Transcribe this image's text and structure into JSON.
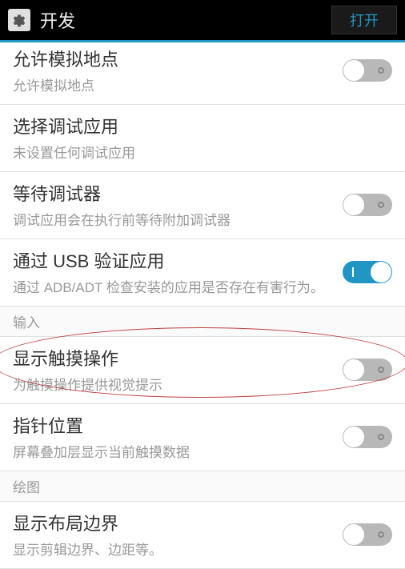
{
  "header": {
    "title": "开发",
    "open_button": "打开"
  },
  "settings": {
    "mock_location": {
      "title": "允许模拟地点",
      "subtitle": "允许模拟地点",
      "enabled": false
    },
    "debug_app": {
      "title": "选择调试应用",
      "subtitle": "未设置任何调试应用"
    },
    "wait_debugger": {
      "title": "等待调试器",
      "subtitle": "调试应用会在执行前等待附加调试器",
      "enabled": false
    },
    "usb_verify": {
      "title": "通过 USB 验证应用",
      "subtitle": "通过 ADB/ADT 检查安装的应用是否存在有害行为。",
      "enabled": true
    },
    "show_touches": {
      "title": "显示触摸操作",
      "subtitle": "为触摸操作提供视觉提示",
      "enabled": false
    },
    "pointer_location": {
      "title": "指针位置",
      "subtitle": "屏幕叠加层显示当前触摸数据",
      "enabled": false
    },
    "layout_bounds": {
      "title": "显示布局边界",
      "subtitle": "显示剪辑边界、边距等。",
      "enabled": false
    }
  },
  "sections": {
    "input": "输入",
    "drawing": "绘图"
  }
}
